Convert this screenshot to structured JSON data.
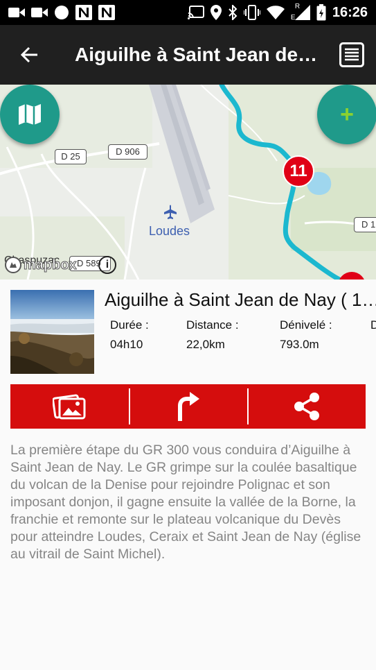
{
  "status_bar": {
    "time": "16:26",
    "network_label": "E",
    "roaming_label": "R",
    "icons": [
      "video-icon",
      "video-icon",
      "circle-icon",
      "n-notification-icon",
      "n-notification-icon",
      "cast-icon",
      "location-icon",
      "bluetooth-icon",
      "vibrate-icon",
      "wifi-icon",
      "signal-icon",
      "battery-icon"
    ]
  },
  "app_bar": {
    "back_icon": "arrow-back-icon",
    "title": "Aiguilhe à Saint Jean de…",
    "list_icon": "list-icon"
  },
  "map": {
    "road_labels": [
      "D 25",
      "D 906",
      "D 1",
      "D 589"
    ],
    "place_label": "Loudes",
    "partial_place_label": "Chaspuzac",
    "marker_label": "11",
    "attribution": "mapbox",
    "info_label": "i",
    "map_button_icon": "map-icon",
    "add_button_label": "+"
  },
  "route": {
    "title": "Aiguilhe à Saint Jean de Nay ( 1…",
    "stats": [
      {
        "label": "Durée :",
        "value": "04h10"
      },
      {
        "label": "Distance :",
        "value": "22,0km"
      },
      {
        "label": "Dénivelé :",
        "value": "793.0m"
      },
      {
        "label": "D",
        "value": ""
      }
    ]
  },
  "actions": [
    {
      "icon": "photos-icon"
    },
    {
      "icon": "directions-icon"
    },
    {
      "icon": "share-icon"
    }
  ],
  "description": "La première étape du GR 300 vous conduira d’Aiguilhe à Saint Jean de Nay. Le GR grimpe sur la coulée basaltique du volcan de la Denise pour rejoindre Polignac et son imposant donjon, il gagne ensuite la vallée de la Borne, la franchie et remonte sur le plateau volcanique du Devès pour atteindre Loudes, Ceraix et Saint Jean de Nay (église au vitrail de Saint Michel).",
  "colors": {
    "accent_red": "#d50d0d",
    "fab_teal": "#1f9a8a",
    "route_blue": "#1cb8cf",
    "app_bar": "#202020",
    "plus_green": "#8bd130"
  }
}
